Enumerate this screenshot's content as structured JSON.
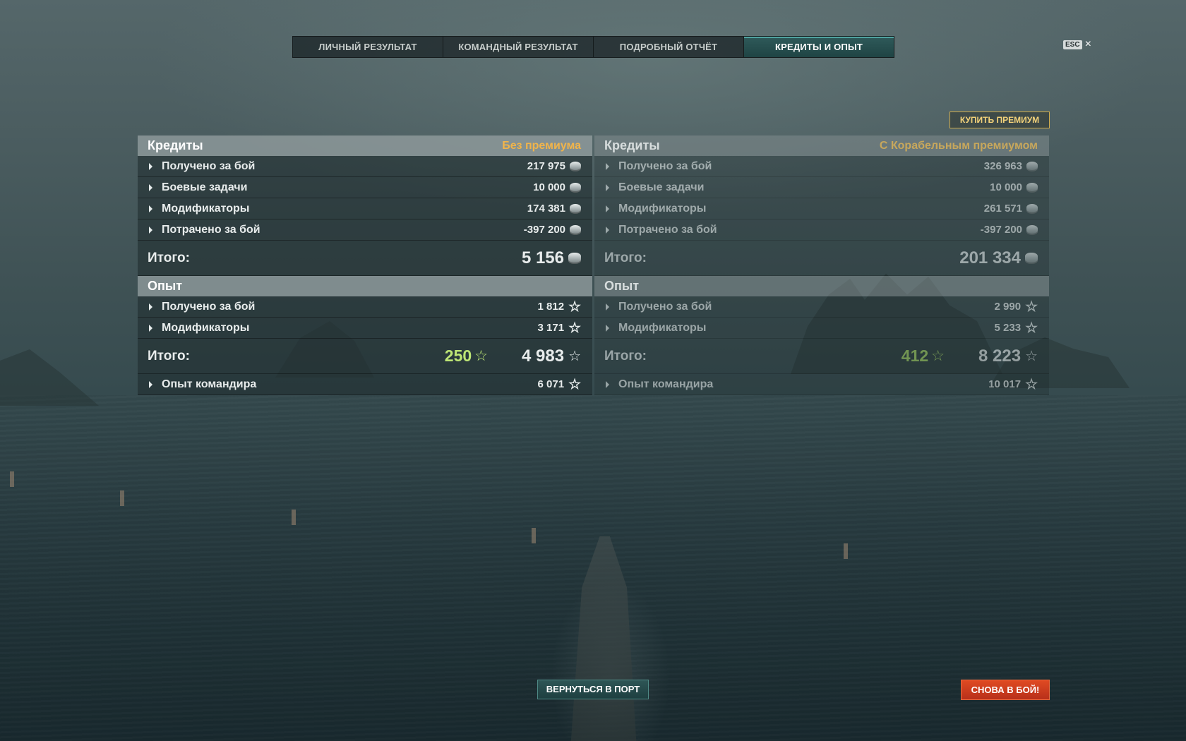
{
  "tabs": [
    "ЛИЧНЫЙ РЕЗУЛЬТАТ",
    "КОМАНДНЫЙ РЕЗУЛЬТАТ",
    "ПОДРОБНЫЙ ОТЧЁТ",
    "КРЕДИТЫ И ОПЫТ"
  ],
  "active_tab": "КРЕДИТЫ И ОПЫТ",
  "close": {
    "key": "ESC",
    "icon": "×"
  },
  "buy_premium": "КУПИТЬ ПРЕМИУМ",
  "left": {
    "credits_title": "Кредиты",
    "mode": "Без премиума",
    "credits": [
      {
        "label": "Получено за бой",
        "value": "217 975"
      },
      {
        "label": "Боевые задачи",
        "value": "10 000"
      },
      {
        "label": "Модификаторы",
        "value": "174 381"
      },
      {
        "label": "Потрачено за бой",
        "value": "-397 200"
      }
    ],
    "credits_total_label": "Итого:",
    "credits_total": "5 156",
    "exp_title": "Опыт",
    "exp": [
      {
        "label": "Получено за бой",
        "value": "1 812"
      },
      {
        "label": "Модификаторы",
        "value": "3 171"
      }
    ],
    "exp_total_label": "Итого:",
    "exp_free": "250",
    "exp_total": "4 983",
    "commander_label": "Опыт командира",
    "commander_value": "6 071"
  },
  "right": {
    "credits_title": "Кредиты",
    "mode": "С Корабельным премиумом",
    "credits": [
      {
        "label": "Получено за бой",
        "value": "326 963"
      },
      {
        "label": "Боевые задачи",
        "value": "10 000"
      },
      {
        "label": "Модификаторы",
        "value": "261 571"
      },
      {
        "label": "Потрачено за бой",
        "value": "-397 200"
      }
    ],
    "credits_total_label": "Итого:",
    "credits_total": "201 334",
    "exp_title": "Опыт",
    "exp": [
      {
        "label": "Получено за бой",
        "value": "2 990"
      },
      {
        "label": "Модификаторы",
        "value": "5 233"
      }
    ],
    "exp_total_label": "Итого:",
    "exp_free": "412",
    "exp_total": "8 223",
    "commander_label": "Опыт командира",
    "commander_value": "10 017"
  },
  "buttons": {
    "port": "ВЕРНУТЬСЯ В ПОРТ",
    "battle": "СНОВА В БОЙ!"
  },
  "icons": {
    "credit": "credit-coin-icon",
    "xp": "star-icon",
    "expand": "triangle-right-icon"
  },
  "colors": {
    "active_tab": "#1f4444",
    "premium_label": "#f1b44a",
    "free_xp": "#bde575",
    "battle_button": "#d03c1e"
  }
}
